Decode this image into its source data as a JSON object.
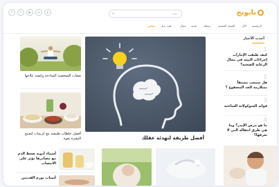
{
  "header": {
    "logo_text": "بابونج",
    "search_placeholder": "بحث",
    "social": [
      {
        "icon": "facebook-icon",
        "glyph": "f"
      },
      {
        "icon": "twitter-icon",
        "glyph": "t"
      },
      {
        "icon": "youtube-icon",
        "glyph": "▶"
      },
      {
        "icon": "instagram-icon",
        "glyph": "◎"
      },
      {
        "icon": "pinterest-icon",
        "glyph": "p"
      }
    ]
  },
  "nav": {
    "items": [
      {
        "label": "الرئيسية",
        "active": false
      },
      {
        "label": "الأم",
        "active": false
      },
      {
        "label": "الصحة النفسية",
        "active": false
      },
      {
        "label": "رشاقة",
        "active": false
      },
      {
        "label": "تغذية",
        "active": false
      },
      {
        "label": "جمال",
        "active": false
      },
      {
        "label": "طب بديل",
        "active": false
      },
      {
        "label": "حياتي",
        "active": true
      }
    ]
  },
  "left": {
    "articles": [
      {
        "title": "صفات الشخصية السادجة وكيفية علاجها"
      },
      {
        "title": "أفضل خلطات طبيعية مع كريمات لتفتيح البشرة بقوة"
      }
    ]
  },
  "main": {
    "title": "أفضل طريقة لتهدئة عقلك"
  },
  "sidebar": {
    "title": "أحدث الأخبار",
    "items": [
      {
        "num": "1",
        "text": "كيف طبقت الإمارات إجراءات البيئة في مجال الرعاية الصحية؟"
      },
      {
        "num": "2",
        "text": "هل سمعت مسبقاً بمتلازمة الخد المصفوع ؟"
      },
      {
        "num": "3",
        "text": "فوائد الشوكولاتة الساخنة"
      },
      {
        "num": "4",
        "text": "ما هو مرض الإيدز؟ وما هي طرق انتقاله التي لا تعرفها؟"
      }
    ]
  },
  "bottom": {
    "left_items": [
      {
        "title": "أسماء أدوية ضغط الدم مع مصادرها تؤثر على الانتصاب"
      },
      {
        "title": "أسباب تورم القدمين"
      }
    ]
  },
  "colors": {
    "accent": "#f0a21a",
    "chalkboard": "#4e5d6e",
    "bulb": "#f7d21f"
  }
}
